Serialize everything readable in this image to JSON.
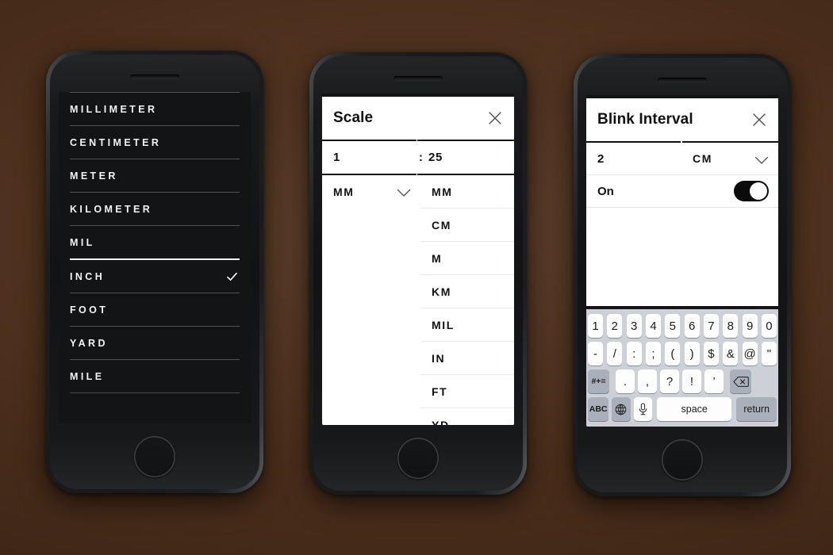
{
  "scene": {
    "background": "dark-walnut-wood",
    "device_count": 3
  },
  "phone1": {
    "screen_name": "unit-picker",
    "items": [
      {
        "label": "MILLIMETER",
        "selected": false
      },
      {
        "label": "CENTIMETER",
        "selected": false
      },
      {
        "label": "METER",
        "selected": false
      },
      {
        "label": "KILOMETER",
        "selected": false
      },
      {
        "label": "MIL",
        "selected": false
      },
      {
        "label": "INCH",
        "selected": true
      },
      {
        "label": "FOOT",
        "selected": false
      },
      {
        "label": "YARD",
        "selected": false
      },
      {
        "label": "MILE",
        "selected": false
      }
    ],
    "check_icon": "check-icon"
  },
  "phone2": {
    "title": "Scale",
    "close_icon": "close-icon",
    "ratio_left": "1",
    "ratio_separator": ":",
    "ratio_right": "25",
    "unit_selected": "MM",
    "chevron_icon": "chevron-down-icon",
    "dropdown_options": [
      "MM",
      "CM",
      "M",
      "KM",
      "MIL",
      "IN",
      "FT",
      "YD"
    ]
  },
  "phone3": {
    "title": "Blink Interval",
    "close_icon": "close-icon",
    "value": "2",
    "unit_selected": "CM",
    "chevron_icon": "chevron-down-icon",
    "toggle_label": "On",
    "toggle_state": "on",
    "keyboard": {
      "row1": [
        "1",
        "2",
        "3",
        "4",
        "5",
        "6",
        "7",
        "8",
        "9",
        "0"
      ],
      "row2": [
        "-",
        "/",
        ":",
        ";",
        "(",
        ")",
        "$",
        "&",
        "@",
        "\""
      ],
      "row3_symbol": "#+=",
      "row3": [
        ".",
        ",",
        "?",
        "!",
        "’"
      ],
      "row3_backspace_icon": "backspace-icon",
      "row4_abc": "ABC",
      "row4_globe_icon": "globe-icon",
      "row4_mic_icon": "microphone-icon",
      "row4_space": "space",
      "row4_return": "return"
    }
  },
  "colors": {
    "wood": "#4a2e1c",
    "panel_bg": "#ffffff",
    "dark_screen": "#131415",
    "keyboard_bg": "#cdd1d7",
    "key_bg": "#fdfdfd",
    "key_gray": "#a9b0bb",
    "accent": "#111111"
  }
}
